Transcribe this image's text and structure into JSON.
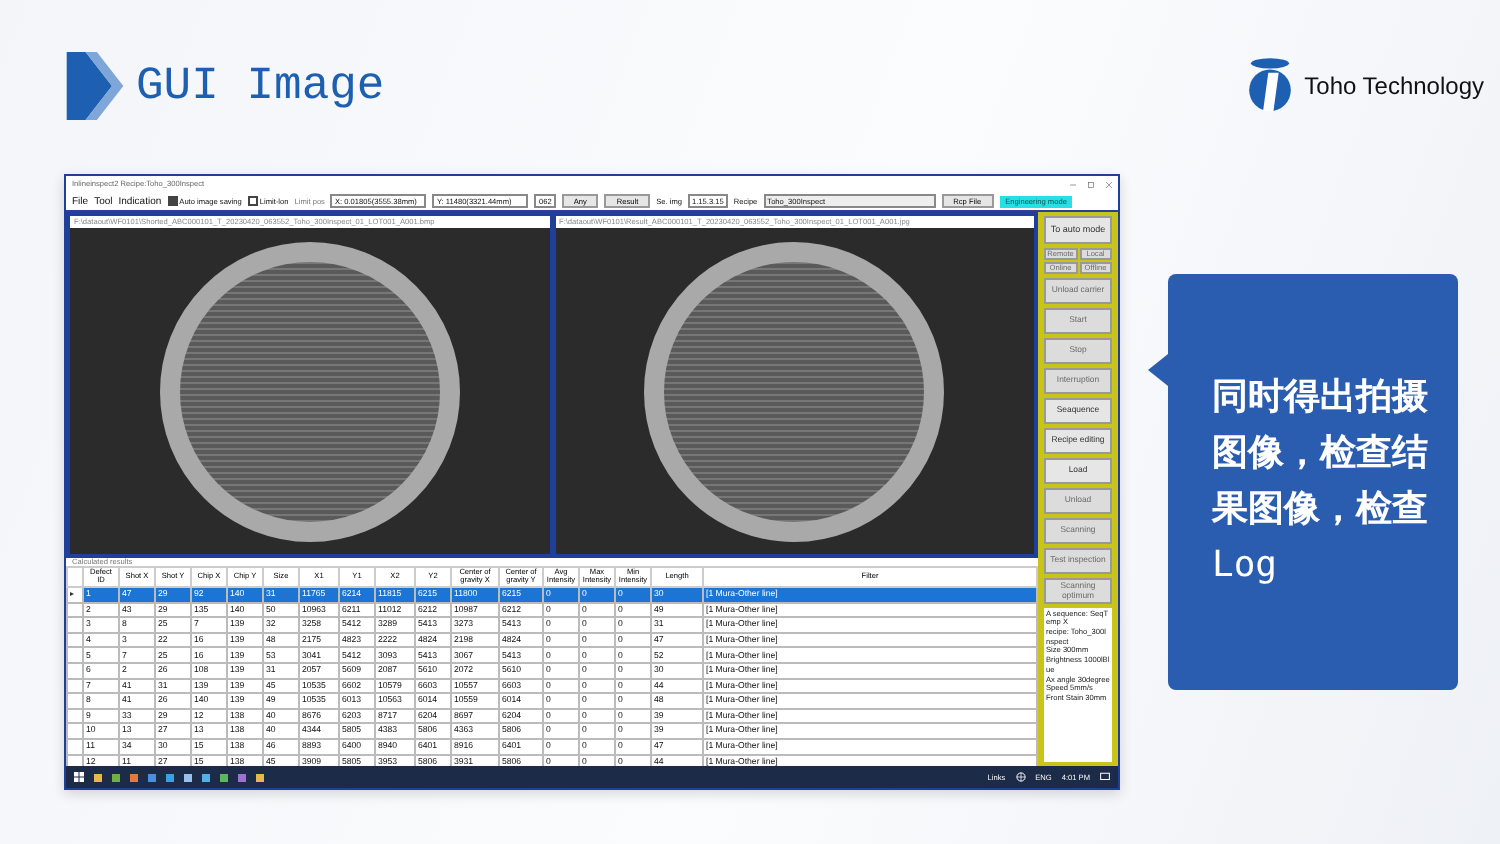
{
  "slide": {
    "title": "GUI Image",
    "logo_text": "Toho Technology",
    "callout": "**同时得出拍摄图像，检查结果图像，检查**Log"
  },
  "app": {
    "window_title": "Inlineinspect2 Recipe:Toho_300Inspect",
    "menu": [
      "File",
      "Tool",
      "Indication"
    ],
    "options": [
      {
        "label": "Auto image saving",
        "checked": true
      },
      {
        "label": "Limit-lon",
        "checked": false
      }
    ],
    "limit_pos": {
      "label": "Limit pos",
      "disabled": true
    },
    "fields": [
      "X: 0.01805(3555.38mm)",
      "Y: 11480(3321.44mm)",
      "062"
    ],
    "buttons": [
      "Any",
      "Result"
    ],
    "se_img": {
      "label": "Se. img",
      "value": "1.15.3.15"
    },
    "recipe": {
      "label": "Recipe",
      "value": "Toho_300Inspect"
    },
    "rcp_file": "Rcp File",
    "mode_badge": "Engineering mode"
  },
  "image_panes": [
    {
      "path": "F:\\dataout\\WF0101\\Shorted_ABC000101_T_20230420_063552_Toho_300Inspect_01_LOT001_A001.bmp"
    },
    {
      "path": "F:\\dataout\\WF0101\\Result_ABC000101_T_20230420_063552_Toho_300Inspect_01_LOT001_A001.jpg"
    }
  ],
  "panel": {
    "mode_button": "To auto mode",
    "small_buttons": [
      {
        "label": "Remote",
        "disabled": true
      },
      {
        "label": "Local",
        "disabled": true
      },
      {
        "label": "Online",
        "disabled": true
      },
      {
        "label": "Offline",
        "disabled": true
      }
    ],
    "buttons": [
      {
        "label": "Unload carrier",
        "disabled": true
      },
      {
        "label": "Start",
        "disabled": true
      },
      {
        "label": "Stop",
        "disabled": true
      },
      {
        "label": "Interruption",
        "disabled": true
      },
      {
        "label": "Seaquence",
        "disabled": false
      },
      {
        "label": "Recipe editing",
        "disabled": false
      },
      {
        "label": "Load",
        "disabled": false
      },
      {
        "label": "Unload",
        "disabled": true
      },
      {
        "label": "Scanning",
        "disabled": true
      },
      {
        "label": "Test inspection",
        "disabled": true
      },
      {
        "label": "Scanning optimum",
        "disabled": true
      }
    ],
    "info": [
      "A sequence: SeqTemp X",
      "recipe: Toho_300Inspect",
      "Size 300mm",
      "Brightness 1000lBlue",
      "Ax angle 30degree",
      "Speed 5mm/s",
      "Front Stain 30mm"
    ]
  },
  "results": {
    "title": "Calculated results",
    "columns": [
      "Defect ID",
      "Shot X",
      "Shot Y",
      "Chip X",
      "Chip Y",
      "Size",
      "X1",
      "Y1",
      "X2",
      "Y2",
      "Center of gravity X",
      "Center of gravity Y",
      "Avg Intensity",
      "Max Intensity",
      "Min Intensity",
      "Length",
      "Filter"
    ],
    "rows": [
      {
        "selected": true,
        "cells": [
          "1",
          "47",
          "29",
          "92",
          "140",
          "31",
          "11765",
          "6214",
          "11815",
          "6215",
          "11800",
          "6215",
          "0",
          "0",
          "0",
          "30",
          "[1 Mura-Other line]"
        ]
      },
      {
        "selected": false,
        "cells": [
          "2",
          "43",
          "29",
          "135",
          "140",
          "50",
          "10963",
          "6211",
          "11012",
          "6212",
          "10987",
          "6212",
          "0",
          "0",
          "0",
          "49",
          "[1 Mura-Other line]"
        ]
      },
      {
        "selected": false,
        "cells": [
          "3",
          "8",
          "25",
          "7",
          "139",
          "32",
          "3258",
          "5412",
          "3289",
          "5413",
          "3273",
          "5413",
          "0",
          "0",
          "0",
          "31",
          "[1 Mura-Other line]"
        ]
      },
      {
        "selected": false,
        "cells": [
          "4",
          "3",
          "22",
          "16",
          "139",
          "48",
          "2175",
          "4823",
          "2222",
          "4824",
          "2198",
          "4824",
          "0",
          "0",
          "0",
          "47",
          "[1 Mura-Other line]"
        ]
      },
      {
        "selected": false,
        "cells": [
          "5",
          "7",
          "25",
          "16",
          "139",
          "53",
          "3041",
          "5412",
          "3093",
          "5413",
          "3067",
          "5413",
          "0",
          "0",
          "0",
          "52",
          "[1 Mura-Other line]"
        ]
      },
      {
        "selected": false,
        "cells": [
          "6",
          "2",
          "26",
          "108",
          "139",
          "31",
          "2057",
          "5609",
          "2087",
          "5610",
          "2072",
          "5610",
          "0",
          "0",
          "0",
          "30",
          "[1 Mura-Other line]"
        ]
      },
      {
        "selected": false,
        "cells": [
          "7",
          "41",
          "31",
          "139",
          "139",
          "45",
          "10535",
          "6602",
          "10579",
          "6603",
          "10557",
          "6603",
          "0",
          "0",
          "0",
          "44",
          "[1 Mura-Other line]"
        ]
      },
      {
        "selected": false,
        "cells": [
          "8",
          "41",
          "26",
          "140",
          "139",
          "49",
          "10535",
          "6013",
          "10563",
          "6014",
          "10559",
          "6014",
          "0",
          "0",
          "0",
          "48",
          "[1 Mura-Other line]"
        ]
      },
      {
        "selected": false,
        "cells": [
          "9",
          "33",
          "29",
          "12",
          "138",
          "40",
          "8676",
          "6203",
          "8717",
          "6204",
          "8697",
          "6204",
          "0",
          "0",
          "0",
          "39",
          "[1 Mura-Other line]"
        ]
      },
      {
        "selected": false,
        "cells": [
          "10",
          "13",
          "27",
          "13",
          "138",
          "40",
          "4344",
          "5805",
          "4383",
          "5806",
          "4363",
          "5806",
          "0",
          "0",
          "0",
          "39",
          "[1 Mura-Other line]"
        ]
      },
      {
        "selected": false,
        "cells": [
          "11",
          "34",
          "30",
          "15",
          "138",
          "46",
          "8893",
          "6400",
          "8940",
          "6401",
          "8916",
          "6401",
          "0",
          "0",
          "0",
          "47",
          "[1 Mura-Other line]"
        ]
      },
      {
        "selected": false,
        "cells": [
          "12",
          "11",
          "27",
          "15",
          "138",
          "45",
          "3909",
          "5805",
          "3953",
          "5806",
          "3931",
          "5806",
          "0",
          "0",
          "0",
          "44",
          "[1 Mura-Other line]"
        ]
      }
    ]
  },
  "taskbar": {
    "tray": [
      "Links",
      "ENG",
      "4:01 PM"
    ]
  }
}
